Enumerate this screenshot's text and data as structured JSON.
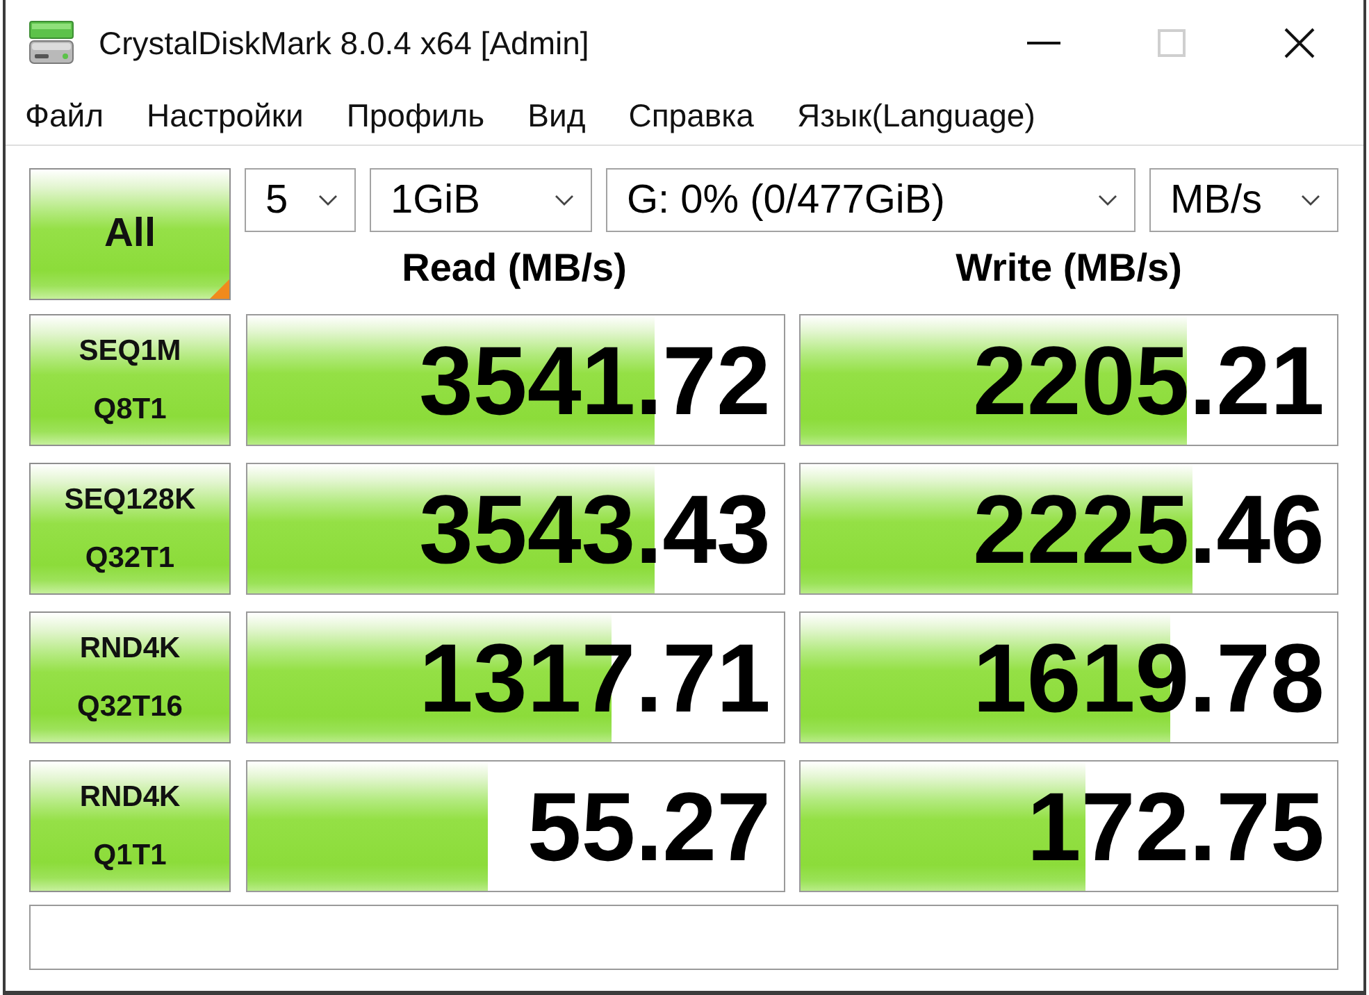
{
  "window": {
    "title": "CrystalDiskMark 8.0.4 x64 [Admin]",
    "controls": [
      {
        "kind": "minimize",
        "disabled": false
      },
      {
        "kind": "maximize",
        "disabled": true
      },
      {
        "kind": "close",
        "disabled": false
      }
    ]
  },
  "menu": [
    "Файл",
    "Настройки",
    "Профиль",
    "Вид",
    "Справка",
    "Язык(Language)"
  ],
  "toolbar": {
    "all_button": "All",
    "dropdowns": [
      {
        "kind": "count",
        "value": "5"
      },
      {
        "kind": "size",
        "value": "1GiB"
      },
      {
        "kind": "drive",
        "value": "G: 0% (0/477GiB)"
      },
      {
        "kind": "unit",
        "value": "MB/s"
      }
    ]
  },
  "columns": {
    "read": "Read (MB/s)",
    "write": "Write (MB/s)"
  },
  "tests": [
    {
      "name": "SEQ1M",
      "params": "Q8T1",
      "read": {
        "value": "3541.72",
        "level": 0.76
      },
      "write": {
        "value": "2205.21",
        "level": 0.72
      }
    },
    {
      "name": "SEQ128K",
      "params": "Q32T1",
      "read": {
        "value": "3543.43",
        "level": 0.76
      },
      "write": {
        "value": "2225.46",
        "level": 0.73
      }
    },
    {
      "name": "RND4K",
      "params": "Q32T16",
      "read": {
        "value": "1317.71",
        "level": 0.68
      },
      "write": {
        "value": "1619.78",
        "level": 0.69
      }
    },
    {
      "name": "RND4K",
      "params": "Q1T1",
      "read": {
        "value": "55.27",
        "level": 0.45
      },
      "write": {
        "value": "172.75",
        "level": 0.53
      }
    }
  ]
}
